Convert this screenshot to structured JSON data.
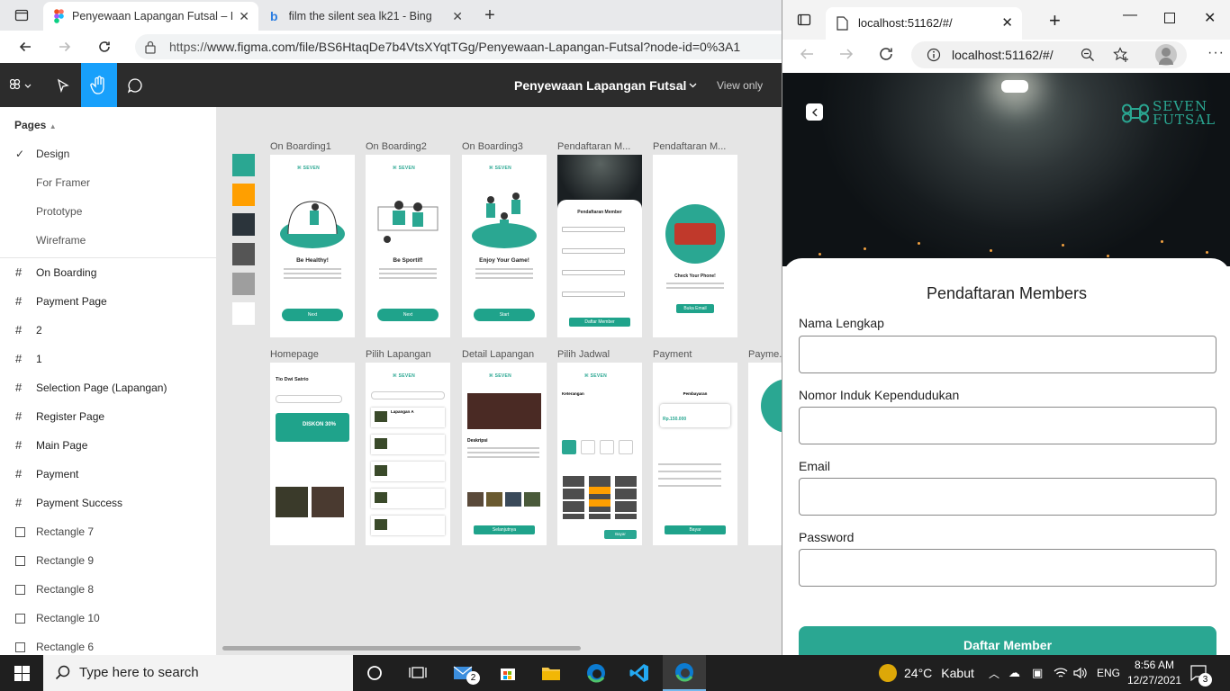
{
  "left_browser": {
    "tabs": [
      {
        "title": "Penyewaan Lapangan Futsal – Fig",
        "active": true
      },
      {
        "title": "film the silent sea lk21 - Bing",
        "active": false
      }
    ],
    "url": {
      "proto": "https://",
      "rest": "www.figma.com/file/BS6HtaqDe7b4VtsXYqtTGg/Penyewaan-Lapangan-Futsal?node-id=0%3A1"
    }
  },
  "figma": {
    "file_title": "Penyewaan Lapangan Futsal",
    "view_mode": "View only",
    "pages_heading": "Pages",
    "pages": [
      "Design",
      "For Framer",
      "Prototype",
      "Wireframe"
    ],
    "layers": [
      {
        "name": "On Boarding",
        "icon": "frame-icon"
      },
      {
        "name": "Payment Page",
        "icon": "frame-icon"
      },
      {
        "name": "2",
        "icon": "frame-icon"
      },
      {
        "name": "1",
        "icon": "frame-icon"
      },
      {
        "name": "Selection Page (Lapangan)",
        "icon": "frame-icon"
      },
      {
        "name": "Register Page",
        "icon": "frame-icon"
      },
      {
        "name": "Main Page",
        "icon": "frame-icon"
      },
      {
        "name": "Payment",
        "icon": "frame-icon"
      },
      {
        "name": "Payment Success",
        "icon": "frame-icon"
      },
      {
        "name": "Rectangle 7",
        "icon": "rectangle-icon"
      },
      {
        "name": "Rectangle 9",
        "icon": "rectangle-icon"
      },
      {
        "name": "Rectangle 8",
        "icon": "rectangle-icon"
      },
      {
        "name": "Rectangle 10",
        "icon": "rectangle-icon"
      },
      {
        "name": "Rectangle 6",
        "icon": "rectangle-icon"
      }
    ],
    "swatches": [
      "#2aa792",
      "#ff9f00",
      "#2b343b",
      "#555555",
      "#9e9e9e",
      "#ffffff"
    ],
    "frames_row1": [
      {
        "label": "On Boarding1",
        "heading": "Be Healthy!",
        "button": "Next"
      },
      {
        "label": "On Boarding2",
        "heading": "Be Sportif!",
        "button": "Next"
      },
      {
        "label": "On Boarding3",
        "heading": "Enjoy Your Game!",
        "button": "Start"
      },
      {
        "label": "Pendaftaran M...",
        "heading": "Pendaftaran Member",
        "button": "Daftar Member"
      },
      {
        "label": "Pendaftaran M...",
        "heading": "Check Your Phone!",
        "button": "Buka Email"
      }
    ],
    "frames_row2": [
      {
        "label": "Homepage",
        "heading": "Tio Dwi Satrio",
        "badge": "DISKON 30%"
      },
      {
        "label": "Pilih Lapangan",
        "heading": "Lapangan A"
      },
      {
        "label": "Detail Lapangan",
        "heading": "Deskripsi",
        "button": "Selanjutnya"
      },
      {
        "label": "Pilih Jadwal",
        "heading": "Keterangan",
        "button": "Bayar"
      },
      {
        "label": "Payment",
        "heading": "Pembayaran",
        "button": "Bayar"
      },
      {
        "label": "Payme...",
        "heading": ""
      }
    ]
  },
  "right_browser": {
    "tab_title": "localhost:51162/#/",
    "url": "localhost:51162/#/",
    "logo_line1": "SEVEN",
    "logo_line2": "FUTSAL",
    "form": {
      "title": "Pendaftaran Members",
      "fields": [
        {
          "label": "Nama Lengkap",
          "value": ""
        },
        {
          "label": "Nomor Induk Kependudukan",
          "value": ""
        },
        {
          "label": "Email",
          "value": ""
        },
        {
          "label": "Password",
          "value": ""
        }
      ],
      "submit": "Daftar Member"
    }
  },
  "taskbar": {
    "search_placeholder": "Type here to search",
    "mail_badge": "2",
    "weather": "24°C",
    "weather_text": "Kabut",
    "language": "ENG",
    "time": "8:56 AM",
    "date": "12/27/2021",
    "notifications": "3"
  },
  "colors": {
    "accent": "#2aa792",
    "figma_blue": "#18a0fb",
    "orange": "#ff9f00"
  }
}
